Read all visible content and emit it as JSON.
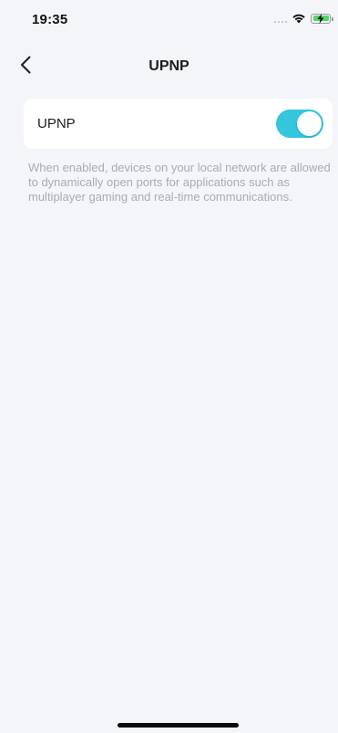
{
  "status_bar": {
    "time": "19:35",
    "icons": [
      "signal-dots-icon",
      "wifi-icon",
      "battery-charging-icon"
    ]
  },
  "nav": {
    "title": "UPNP",
    "back_icon": "chevron-left-icon"
  },
  "setting": {
    "label": "UPNP",
    "toggle_state": "on",
    "toggle_color": "#33c6dd"
  },
  "description": "When enabled, devices on your local network are allowed to dynamically open ports for applications such as multiplayer gaming and real-time communications."
}
